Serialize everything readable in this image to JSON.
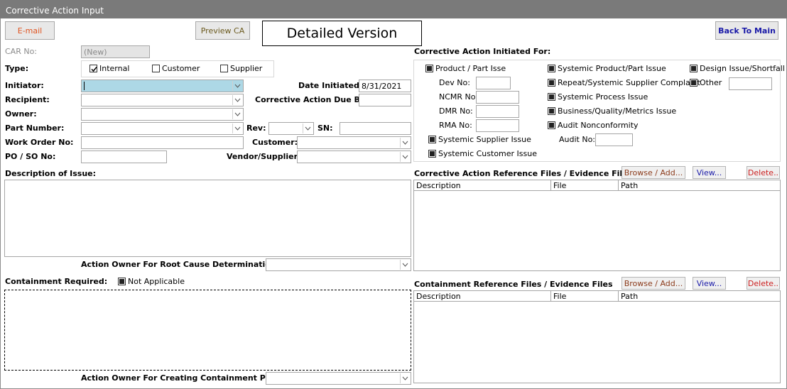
{
  "window": {
    "title": "Corrective Action Input"
  },
  "toolbar": {
    "email": "E-mail",
    "preview": "Preview CA",
    "version": "Detailed Version",
    "back": "Back To Main"
  },
  "colors": {
    "email_text": "#e0531f",
    "preview_text": "#6b5a1e",
    "back_text": "#1a1aa8",
    "browse_text": "#8b3a1a",
    "view_text": "#1a1aa8",
    "delete_text": "#cc1f1f",
    "initiator_bg": "#add8e6"
  },
  "form": {
    "car_no_label": "CAR No:",
    "car_no_value": "(New)",
    "type_label": "Type:",
    "type_internal": "Internal",
    "type_customer": "Customer",
    "type_supplier": "Supplier",
    "initiator_label": "Initiator:",
    "date_initiated_label": "Date Initiated:",
    "date_initiated_value": "8/31/2021",
    "recipient_label": "Recipient:",
    "due_by_label": "Corrective Action Due By:",
    "owner_label": "Owner:",
    "part_number_label": "Part Number:",
    "rev_label": "Rev:",
    "sn_label": "SN:",
    "work_order_label": "Work Order No:",
    "customer_label": "Customer:",
    "po_label": "PO / SO No:",
    "vendor_label": "Vendor/Supplier:",
    "description_label": "Description of Issue:",
    "root_cause_owner_label": "Action Owner For Root Cause Determination:",
    "containment_label": "Containment Required:",
    "not_applicable": "Not Applicable",
    "containment_owner_label": "Action Owner For Creating Containment Plan:"
  },
  "initiated_for": {
    "title": "Corrective Action Initiated For:",
    "product_part": "Product / Part Isse",
    "dev_no": "Dev No:",
    "ncmr_no": "NCMR No:",
    "dmr_no": "DMR No:",
    "rma_no": "RMA No:",
    "systemic_supplier": "Systemic Supplier Issue",
    "systemic_customer": "Systemic Customer Issue",
    "systemic_product": "Systemic Product/Part Issue",
    "repeat_supplier": "Repeat/Systemic Supplier Complaint",
    "systemic_process": "Systemic Process Issue",
    "business_quality": "Business/Quality/Metrics Issue",
    "audit_nonconformity": "Audit Nonconformity",
    "audit_no": "Audit No:",
    "design_issue": "Design Issue/Shortfall",
    "other": "Other"
  },
  "files": {
    "ca_title": "Corrective Action Reference Files / Evidence Files",
    "containment_title": "Containment Reference Files / Evidence Files",
    "browse": "Browse / Add...",
    "view": "View...",
    "delete": "Delete..",
    "columns": [
      "Description",
      "File",
      "Path"
    ]
  }
}
